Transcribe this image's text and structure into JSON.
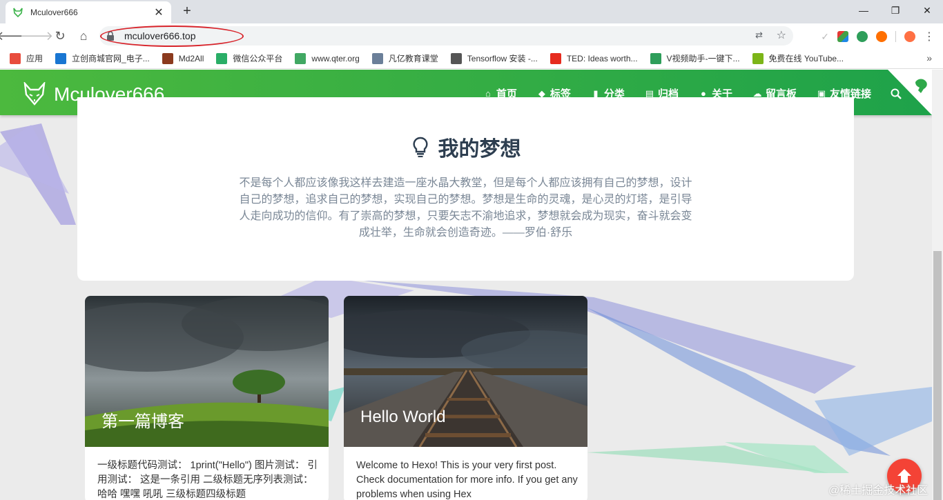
{
  "browser": {
    "tab_title": "Mculover666",
    "url": "mculover666.top",
    "bookmarks": [
      {
        "label": "应用",
        "icon": "apps-grid-icon",
        "color": "#e84c3d"
      },
      {
        "label": "立创商城官网_电子...",
        "icon": "lc-logo-icon",
        "color": "#1976d2"
      },
      {
        "label": "Md2All",
        "icon": "md2all-icon",
        "color": "#8b3a1e"
      },
      {
        "label": "微信公众平台",
        "icon": "wechat-icon",
        "color": "#2aae67"
      },
      {
        "label": "www.qter.org",
        "icon": "qter-icon",
        "color": "#41a863"
      },
      {
        "label": "凡亿教育课堂",
        "icon": "user-circle-icon",
        "color": "#6b7f99"
      },
      {
        "label": "Tensorflow 安装 -...",
        "icon": "globe-icon",
        "color": "#555555"
      },
      {
        "label": "TED: Ideas worth...",
        "icon": "ted-icon",
        "color": "#e62b1e"
      },
      {
        "label": "V视频助手-一键下...",
        "icon": "video-helper-icon",
        "color": "#2e9e5a"
      },
      {
        "label": "免费在线 YouTube...",
        "icon": "download-arrow-icon",
        "color": "#7cb518"
      }
    ]
  },
  "site": {
    "title": "Mculover666",
    "menu": [
      {
        "label": "首页",
        "icon": "home-icon",
        "glyph": "⌂"
      },
      {
        "label": "标签",
        "icon": "tags-icon",
        "glyph": "◆"
      },
      {
        "label": "分类",
        "icon": "bookmark-icon",
        "glyph": "▮"
      },
      {
        "label": "归档",
        "icon": "archive-icon",
        "glyph": "▤"
      },
      {
        "label": "关于",
        "icon": "user-circle-icon",
        "glyph": "●"
      },
      {
        "label": "留言板",
        "icon": "comments-icon",
        "glyph": "☁"
      },
      {
        "label": "友情链接",
        "icon": "address-book-icon",
        "glyph": "▣"
      }
    ],
    "accent_start": "#4cb93e",
    "accent_end": "#1ea24a"
  },
  "dream": {
    "title": "我的梦想",
    "text": "不是每个人都应该像我这样去建造一座水晶大教堂，但是每个人都应该拥有自己的梦想，设计自己的梦想，追求自己的梦想，实现自己的梦想。梦想是生命的灵魂，是心灵的灯塔，是引导人走向成功的信仰。有了崇高的梦想，只要矢志不渝地追求，梦想就会成为现实，奋斗就会变成壮举，生命就会创造奇迹。——罗伯·舒乐"
  },
  "posts": [
    {
      "title": "第一篇博客",
      "excerpt": "一级标题代码测试： 1print(\"Hello\") 图片测试： 引用测试： 这是一条引用 二级标题无序列表测试： 哈哈 嘿嘿 吼吼 三级标题四级标题"
    },
    {
      "title": "Hello World",
      "excerpt": "Welcome to Hexo! This is your very first post. Check documentation for more info. If you get any problems when using Hex"
    }
  ],
  "watermark": "@稀土掘金技术社区"
}
